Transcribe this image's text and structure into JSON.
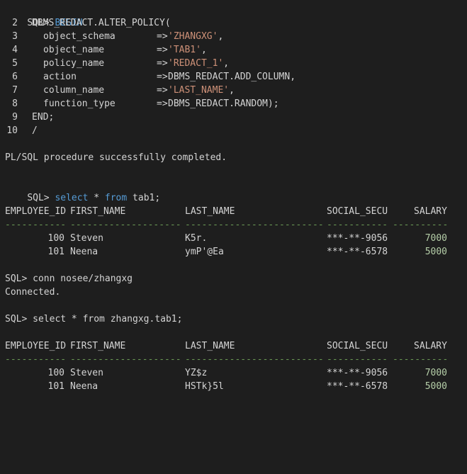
{
  "colors": {
    "background": "#1e1e1e",
    "text": "#d4d4d4",
    "keyword": "#569cd6",
    "string": "#ce9178",
    "separator": "#6a9955",
    "number": "#b5cea8"
  },
  "block": {
    "prompt": "SQL>",
    "begin": "BEGIN",
    "lines": [
      {
        "num": "2",
        "text": "DBMS_REDACT.ALTER_POLICY("
      },
      {
        "num": "3",
        "name": "object_schema",
        "arrow": "=>",
        "value": "'ZHANGXG'",
        "suffix": ","
      },
      {
        "num": "4",
        "name": "object_name",
        "arrow": "=>",
        "value": "'TAB1'",
        "suffix": ","
      },
      {
        "num": "5",
        "name": "policy_name",
        "arrow": "=>",
        "value": "'REDACT_1'",
        "suffix": ","
      },
      {
        "num": "6",
        "name": "action",
        "arrow": "=>",
        "value": "DBMS_REDACT.ADD_COLUMN",
        "suffix": ","
      },
      {
        "num": "7",
        "name": "column_name",
        "arrow": "=>",
        "value": "'LAST_NAME'",
        "suffix": ","
      },
      {
        "num": "8",
        "name": "function_type",
        "arrow": "=>",
        "value": "DBMS_REDACT.RANDOM",
        "suffix": ");"
      },
      {
        "num": "9",
        "text": "END;"
      },
      {
        "num": "10",
        "text": "/"
      }
    ]
  },
  "msg_completed": "PL/SQL procedure successfully completed.",
  "query1": {
    "prompt": "SQL>",
    "select": "select",
    "star": "*",
    "from": "from",
    "table": "tab1;"
  },
  "headers": [
    "EMPLOYEE_ID",
    "FIRST_NAME",
    "LAST_NAME",
    "SOCIAL_SECU",
    "SALARY"
  ],
  "separators": [
    "-----------",
    "--------------------",
    "-------------------------",
    "-----------",
    "----------"
  ],
  "result1": [
    {
      "id": "100",
      "first": "Steven",
      "last": "K5r.",
      "ssn": "***-**-9056",
      "salary": "7000"
    },
    {
      "id": "101",
      "first": "Neena",
      "last": "ymP'@Ea",
      "ssn": "***-**-6578",
      "salary": "5000"
    }
  ],
  "conn_cmd": "SQL> conn nosee/zhangxg",
  "connected": "Connected.",
  "query2": "SQL> select * from zhangxg.tab1;",
  "result2": [
    {
      "id": "100",
      "first": "Steven",
      "last": "YZ$z",
      "ssn": "***-**-9056",
      "salary": "7000"
    },
    {
      "id": "101",
      "first": "Neena",
      "last": "HSTk}5l",
      "ssn": "***-**-6578",
      "salary": "5000"
    }
  ]
}
